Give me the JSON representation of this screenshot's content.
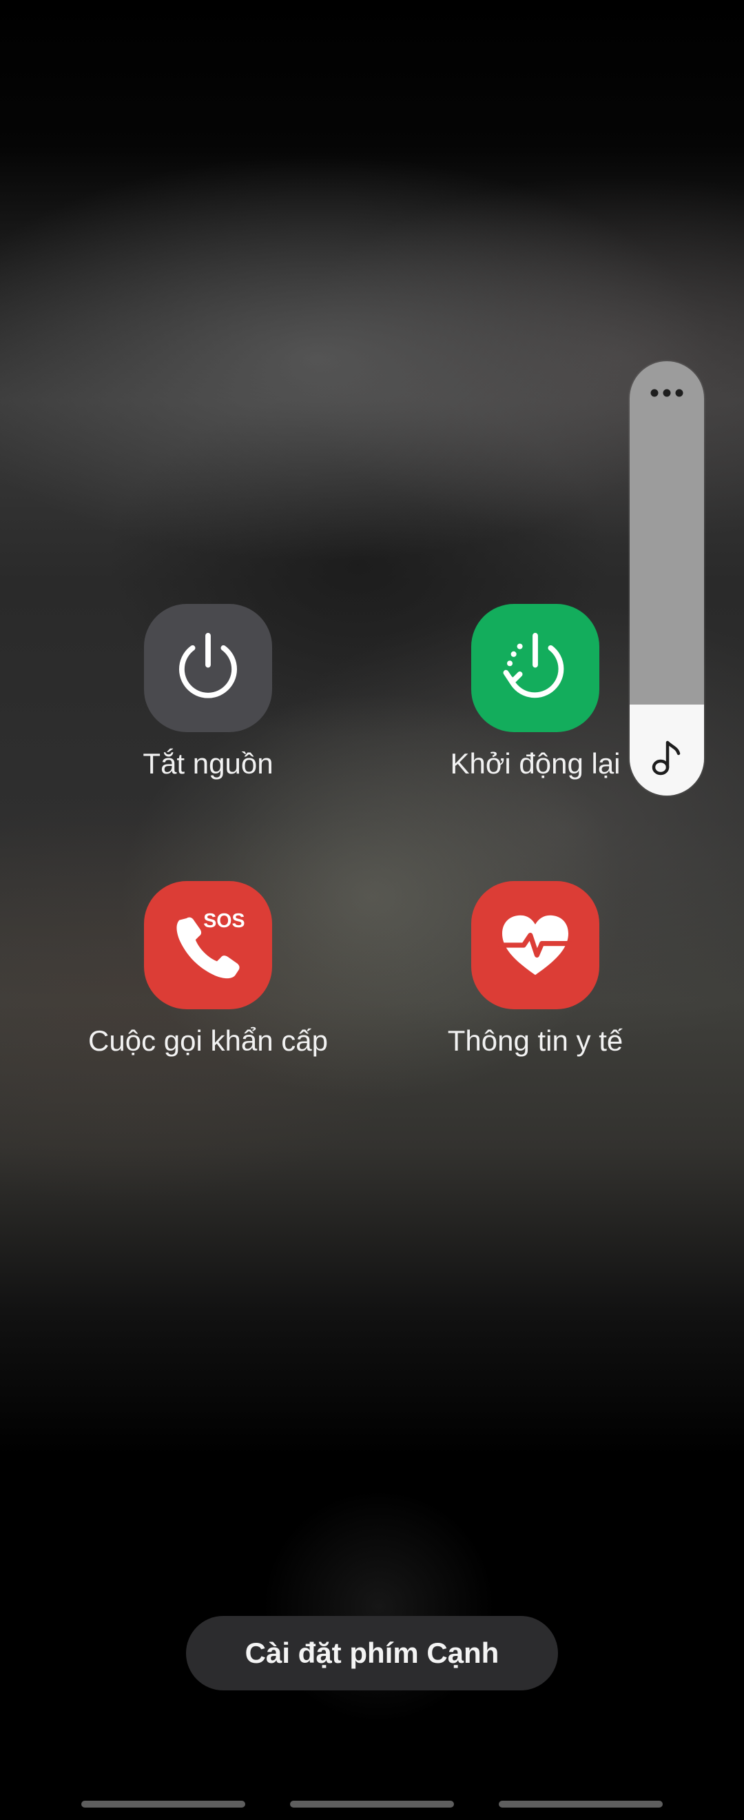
{
  "power_menu": {
    "actions": [
      {
        "id": "power-off",
        "label": "Tắt nguồn",
        "icon": "power-icon",
        "color": "#4a4a4e"
      },
      {
        "id": "restart",
        "label": "Khởi động lại",
        "icon": "restart-icon",
        "color": "#13ad5c"
      },
      {
        "id": "emergency-call",
        "label": "Cuộc gọi khẩn cấp",
        "icon": "sos-phone-icon",
        "icon_text": "SOS",
        "color": "#dc3d36"
      },
      {
        "id": "medical-info",
        "label": "Thông tin y tế",
        "icon": "heart-pulse-icon",
        "color": "#dc3d36"
      }
    ],
    "side_key_settings_label": "Cài đặt phím Cạnh"
  },
  "volume_panel": {
    "level_fraction": 0.21,
    "more_icon": "more-dots-icon",
    "stream_icon": "music-note-icon"
  },
  "nav_bar": {
    "items": [
      "recent-apps",
      "home",
      "back"
    ]
  }
}
